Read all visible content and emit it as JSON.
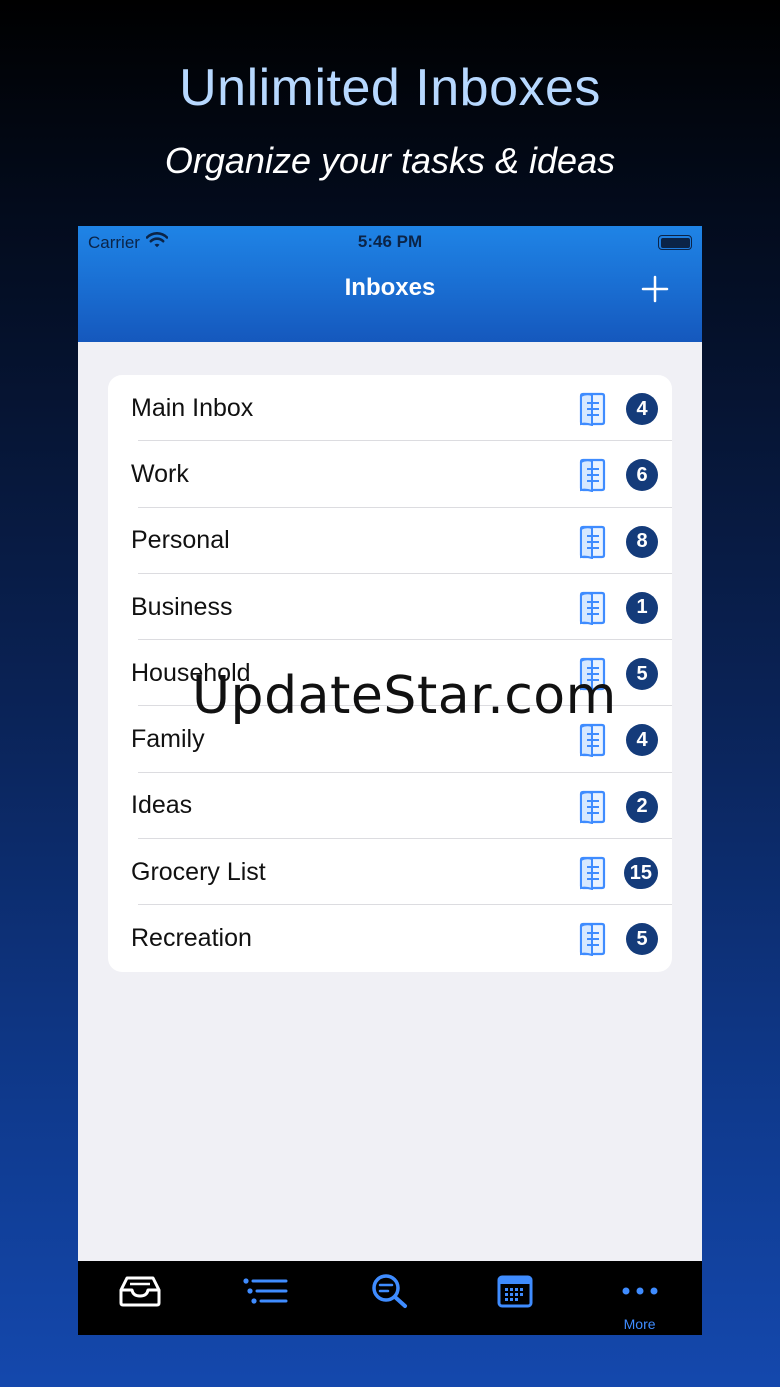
{
  "promo": {
    "title": "Unlimited Inboxes",
    "subtitle": "Organize your tasks & ideas"
  },
  "status_bar": {
    "carrier": "Carrier",
    "time": "5:46 PM"
  },
  "navbar": {
    "title": "Inboxes",
    "add_icon": "plus-icon"
  },
  "inboxes": [
    {
      "label": "Main Inbox",
      "count": "4"
    },
    {
      "label": "Work",
      "count": "6"
    },
    {
      "label": "Personal",
      "count": "8"
    },
    {
      "label": "Business",
      "count": "1"
    },
    {
      "label": "Household",
      "count": "5"
    },
    {
      "label": "Family",
      "count": "4"
    },
    {
      "label": "Ideas",
      "count": "2"
    },
    {
      "label": "Grocery List",
      "count": "15"
    },
    {
      "label": "Recreation",
      "count": "5"
    }
  ],
  "watermark": "UpdateStar.com",
  "tabbar": {
    "tabs": [
      {
        "icon": "inbox-tray-icon",
        "label": ""
      },
      {
        "icon": "list-icon",
        "label": ""
      },
      {
        "icon": "search-icon",
        "label": ""
      },
      {
        "icon": "calendar-icon",
        "label": ""
      },
      {
        "icon": "more-dots-icon",
        "label": "More"
      }
    ]
  },
  "colors": {
    "accent": "#3f8cff",
    "badge": "#143b7a",
    "navbar": "#1a6fd3",
    "promo_title": "#b7d8ff"
  }
}
